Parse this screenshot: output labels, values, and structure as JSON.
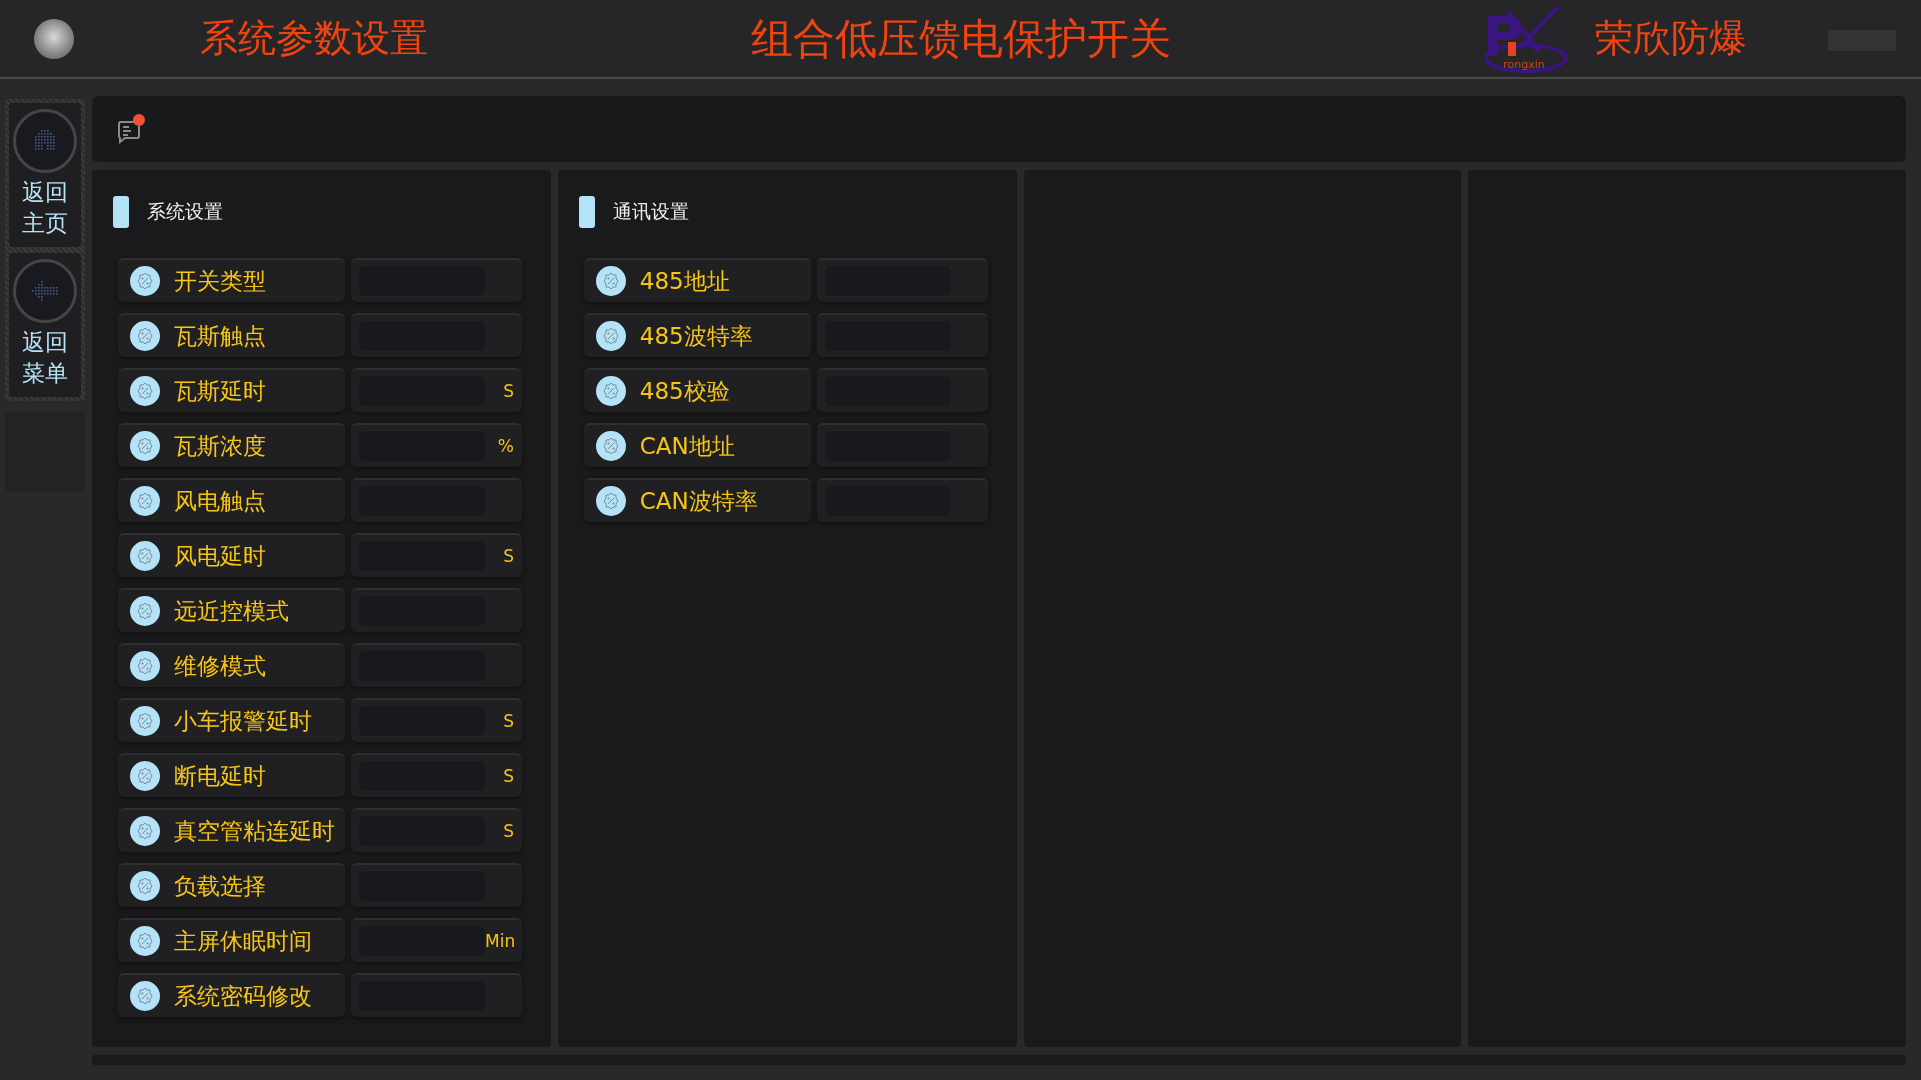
{
  "header": {
    "page_title": "系统参数设置",
    "device_title": "组合低压馈电保护开关",
    "brand": "荣欣防爆",
    "logo_text": "rongxin"
  },
  "sidebar": {
    "items": [
      {
        "kind": "home",
        "label": "返回主页"
      },
      {
        "kind": "back",
        "label": "返回菜单"
      }
    ]
  },
  "notifications": {
    "unread": true
  },
  "panels": [
    {
      "title": "系统设置",
      "rows": [
        {
          "label": "开关类型"
        },
        {
          "label": "瓦斯触点"
        },
        {
          "label": "瓦斯延时",
          "unit": "S"
        },
        {
          "label": "瓦斯浓度",
          "unit": "%"
        },
        {
          "label": "风电触点"
        },
        {
          "label": "风电延时",
          "unit": "S"
        },
        {
          "label": "远近控模式"
        },
        {
          "label": "维修模式"
        },
        {
          "label": "小车报警延时",
          "unit": "S"
        },
        {
          "label": "断电延时",
          "unit": "S"
        },
        {
          "label": "真空管粘连延时",
          "unit": "S"
        },
        {
          "label": "负载选择"
        },
        {
          "label": "主屏休眠时间",
          "unit": "Min"
        },
        {
          "label": "系统密码修改"
        }
      ]
    },
    {
      "title": "通讯设置",
      "rows": [
        {
          "label": "485地址"
        },
        {
          "label": "485波特率"
        },
        {
          "label": "485校验"
        },
        {
          "label": "CAN地址"
        },
        {
          "label": "CAN波特率"
        }
      ]
    }
  ]
}
